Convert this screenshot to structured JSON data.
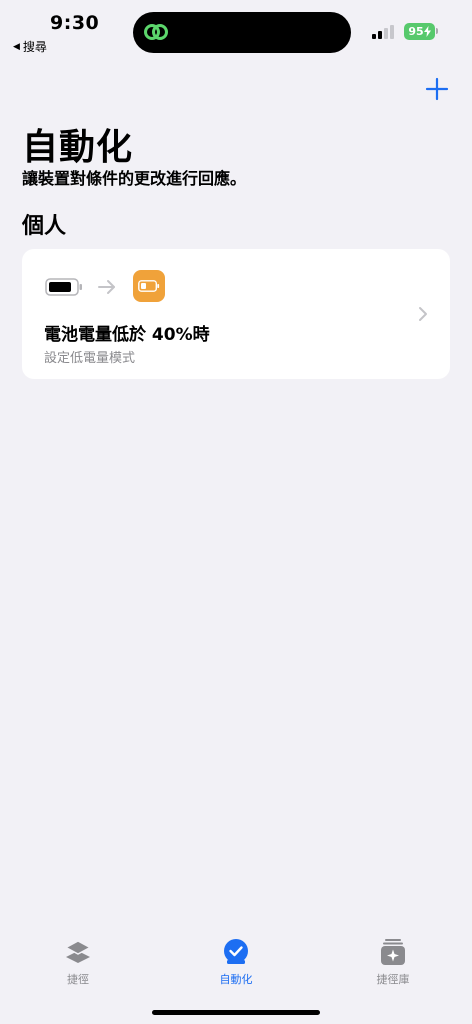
{
  "status_bar": {
    "time": "9:30",
    "back_label": "搜尋",
    "battery_level": "95"
  },
  "header": {
    "title": "自動化",
    "subtitle": "讓裝置對條件的更改進行回應。"
  },
  "section": {
    "title": "個人"
  },
  "automation": {
    "title": "電池電量低於 40%時",
    "subtitle": "設定低電量模式"
  },
  "tabs": [
    {
      "label": "捷徑",
      "icon": "layers-icon",
      "active": false
    },
    {
      "label": "自動化",
      "icon": "clock-check-icon",
      "active": true
    },
    {
      "label": "捷徑庫",
      "icon": "gallery-sparkle-icon",
      "active": false
    }
  ],
  "colors": {
    "accent": "#1d6ef2",
    "low_power": "#f0a23a",
    "battery_green": "#57c96c",
    "background": "#f2f1f6"
  }
}
